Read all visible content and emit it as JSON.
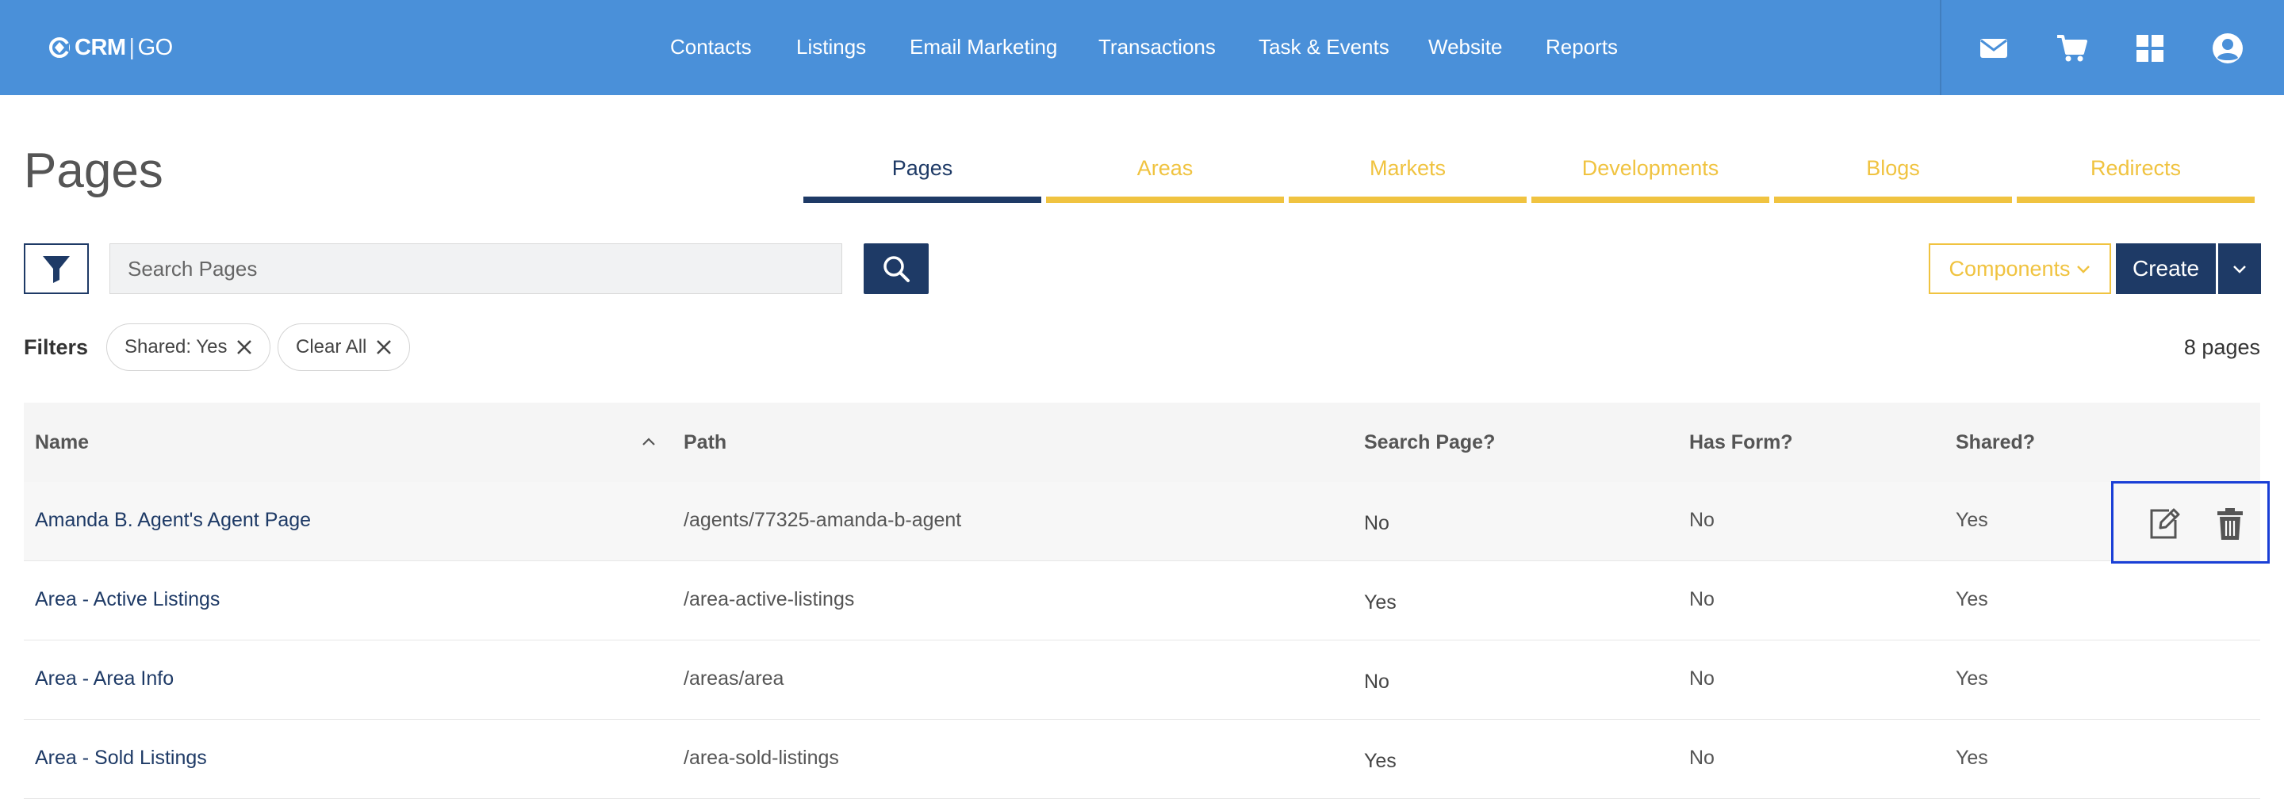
{
  "app": {
    "logo_left": "CRM",
    "logo_right": "GO"
  },
  "nav": {
    "items": [
      {
        "label": "Contacts"
      },
      {
        "label": "Listings"
      },
      {
        "label": "Email Marketing"
      },
      {
        "label": "Transactions"
      },
      {
        "label": "Task & Events"
      },
      {
        "label": "Website"
      },
      {
        "label": "Reports"
      }
    ],
    "icons": [
      "mail-icon",
      "cart-icon",
      "apps-grid-icon",
      "user-account-icon"
    ]
  },
  "page": {
    "title": "Pages",
    "tabs": [
      {
        "label": "Pages",
        "active": true
      },
      {
        "label": "Areas",
        "active": false
      },
      {
        "label": "Markets",
        "active": false
      },
      {
        "label": "Developments",
        "active": false
      },
      {
        "label": "Blogs",
        "active": false
      },
      {
        "label": "Redirects",
        "active": false
      }
    ]
  },
  "toolbar": {
    "search_placeholder": "Search Pages",
    "components_label": "Components",
    "create_label": "Create"
  },
  "filters": {
    "label": "Filters",
    "chips": [
      {
        "label": "Shared: Yes"
      },
      {
        "label": "Clear All"
      }
    ],
    "count_text": "8 pages"
  },
  "table": {
    "columns": [
      "Name",
      "Path",
      "Search Page?",
      "Has Form?",
      "Shared?"
    ],
    "rows": [
      {
        "name": "Amanda B. Agent's Agent Page",
        "path": "/agents/77325-amanda-b-agent",
        "search_page": "No",
        "has_form": "No",
        "shared": "Yes"
      },
      {
        "name": "Area - Active Listings",
        "path": "/area-active-listings",
        "search_page": "Yes",
        "has_form": "No",
        "shared": "Yes"
      },
      {
        "name": "Area - Area Info",
        "path": "/areas/area",
        "search_page": "No",
        "has_form": "No",
        "shared": "Yes"
      },
      {
        "name": "Area - Sold Listings",
        "path": "/area-sold-listings",
        "search_page": "Yes",
        "has_form": "No",
        "shared": "Yes"
      }
    ]
  },
  "colors": {
    "topbar": "#4a90d9",
    "navy": "#1e3a66",
    "gold": "#f0c340",
    "highlight_box": "#1a3fd6"
  }
}
